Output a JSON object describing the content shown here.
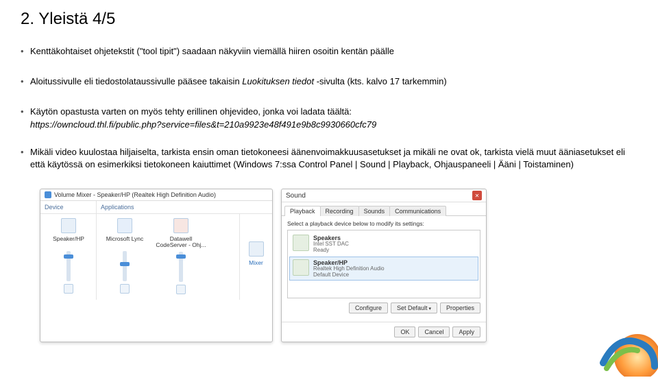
{
  "slide": {
    "title": "2. Yleistä 4/5",
    "bullets": [
      "Kenttäkohtaiset ohjetekstit (\"tool tipit\") saadaan näkyviin viemällä hiiren osoitin kentän päälle",
      "Aloitussivulle eli tiedostolataussivulle pääsee takaisin Luokituksen tiedot -sivulta (kts. kalvo 17 tarkemmin)",
      "Käytön opastusta varten on myös tehty erillinen ohjevideo, jonka voi ladata täältä:",
      "Mikäli video kuulostaa hiljaiselta, tarkista ensin oman tietokoneesi äänenvoimakkuusasetukset ja mikäli ne ovat ok, tarkista vielä muut ääniasetukset eli että käytössä on esimerkiksi tietokoneen kaiuttimet (Windows 7:ssa Control Panel | Sound | Playback, Ohjauspaneeli | Ääni | Toistaminen)"
    ],
    "video_url": "https://owncloud.thl.fi/public.php?service=files&t=210a9923e48f491e9b8c9930660cfc79"
  },
  "volume_mixer": {
    "title": "Volume Mixer - Speaker/HP (Realtek High Definition Audio)",
    "sections": {
      "device": "Device",
      "applications": "Applications"
    },
    "apps": [
      {
        "name": "Speaker/HP",
        "thumb_pct": 10
      },
      {
        "name": "Microsoft Lync",
        "thumb_pct": 35
      },
      {
        "name": "Datawell CodeServer - Ohj...",
        "thumb_pct": 10
      }
    ],
    "mixer_label": "Mixer"
  },
  "sound": {
    "window_title": "Sound",
    "tabs": [
      "Playback",
      "Recording",
      "Sounds",
      "Communications"
    ],
    "active_tab": 0,
    "instruction": "Select a playback device below to modify its settings:",
    "devices": [
      {
        "name": "Speakers",
        "desc": "Intel SST DAC",
        "status": "Ready",
        "selected": false
      },
      {
        "name": "Speaker/HP",
        "desc": "Realtek High Definition Audio",
        "status": "Default Device",
        "selected": true
      }
    ],
    "buttons": {
      "configure": "Configure",
      "set_default": "Set Default",
      "properties": "Properties"
    },
    "footer": {
      "ok": "OK",
      "cancel": "Cancel",
      "apply": "Apply"
    }
  }
}
